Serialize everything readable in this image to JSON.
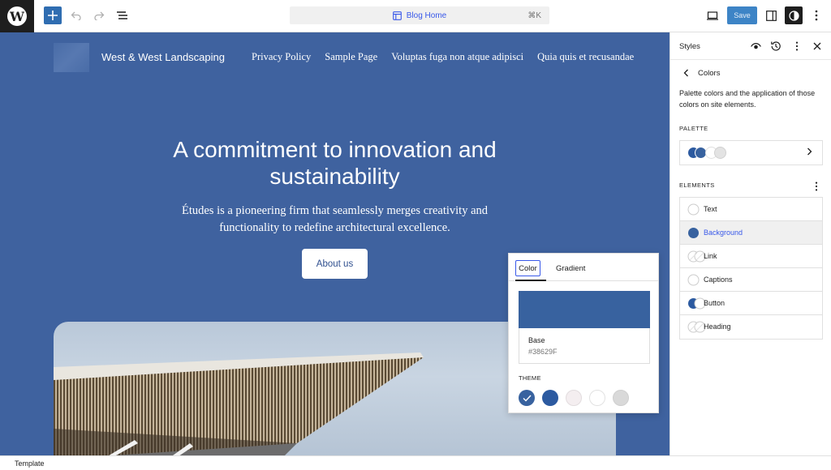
{
  "toolbar": {
    "logo_letter": "W",
    "add_icon": "plus-icon",
    "doc_title": "Blog Home",
    "shortcut": "⌘K",
    "save_label": "Save"
  },
  "site": {
    "title": "West & West Landscaping",
    "nav": [
      "Privacy Policy",
      "Sample Page",
      "Voluptas fuga non atque adipisci",
      "Quia quis et recusandae"
    ],
    "hero_title": "A commitment to innovation and sustainability",
    "hero_subtitle": "Études is a pioneering firm that seamlessly merges creativity and functionality to redefine architectural excellence.",
    "cta": "About us"
  },
  "popover": {
    "tabs": [
      "Color",
      "Gradient"
    ],
    "active_tab": "Color",
    "swatch": {
      "name": "Base",
      "hex": "#38629F"
    },
    "theme_label": "THEME",
    "theme_colors": [
      "#38629f",
      "#2c5aa0",
      "#f4eef0",
      "#ffffff",
      "#d9d9d9"
    ],
    "selected_index": 0
  },
  "sidebar": {
    "title": "Styles",
    "section_title": "Colors",
    "description": "Palette colors and the application of those colors on site elements.",
    "palette_label": "PALETTE",
    "palette_colors": [
      "#2c5aa0",
      "#38629f",
      "#ffffff",
      "#e3e3e3"
    ],
    "elements_label": "ELEMENTS",
    "elements": [
      {
        "label": "Text",
        "indicator": [
          "#ffffff"
        ],
        "selected": false
      },
      {
        "label": "Background",
        "indicator": [
          "#38629f"
        ],
        "selected": true
      },
      {
        "label": "Link",
        "indicator": [
          "#ffffff",
          "#ffffff"
        ],
        "selected": false
      },
      {
        "label": "Captions",
        "indicator": [
          "#ffffff"
        ],
        "selected": false
      },
      {
        "label": "Button",
        "indicator": [
          "#2c5aa0",
          "#ffffff"
        ],
        "selected": false
      },
      {
        "label": "Heading",
        "indicator": [
          "#ffffff",
          "#ffffff"
        ],
        "selected": false
      }
    ]
  },
  "footer": {
    "label": "Template"
  },
  "colors": {
    "canvas": "#3f629f",
    "accent": "#3858e9",
    "save": "#3d84c6",
    "add": "#2f6db1"
  }
}
